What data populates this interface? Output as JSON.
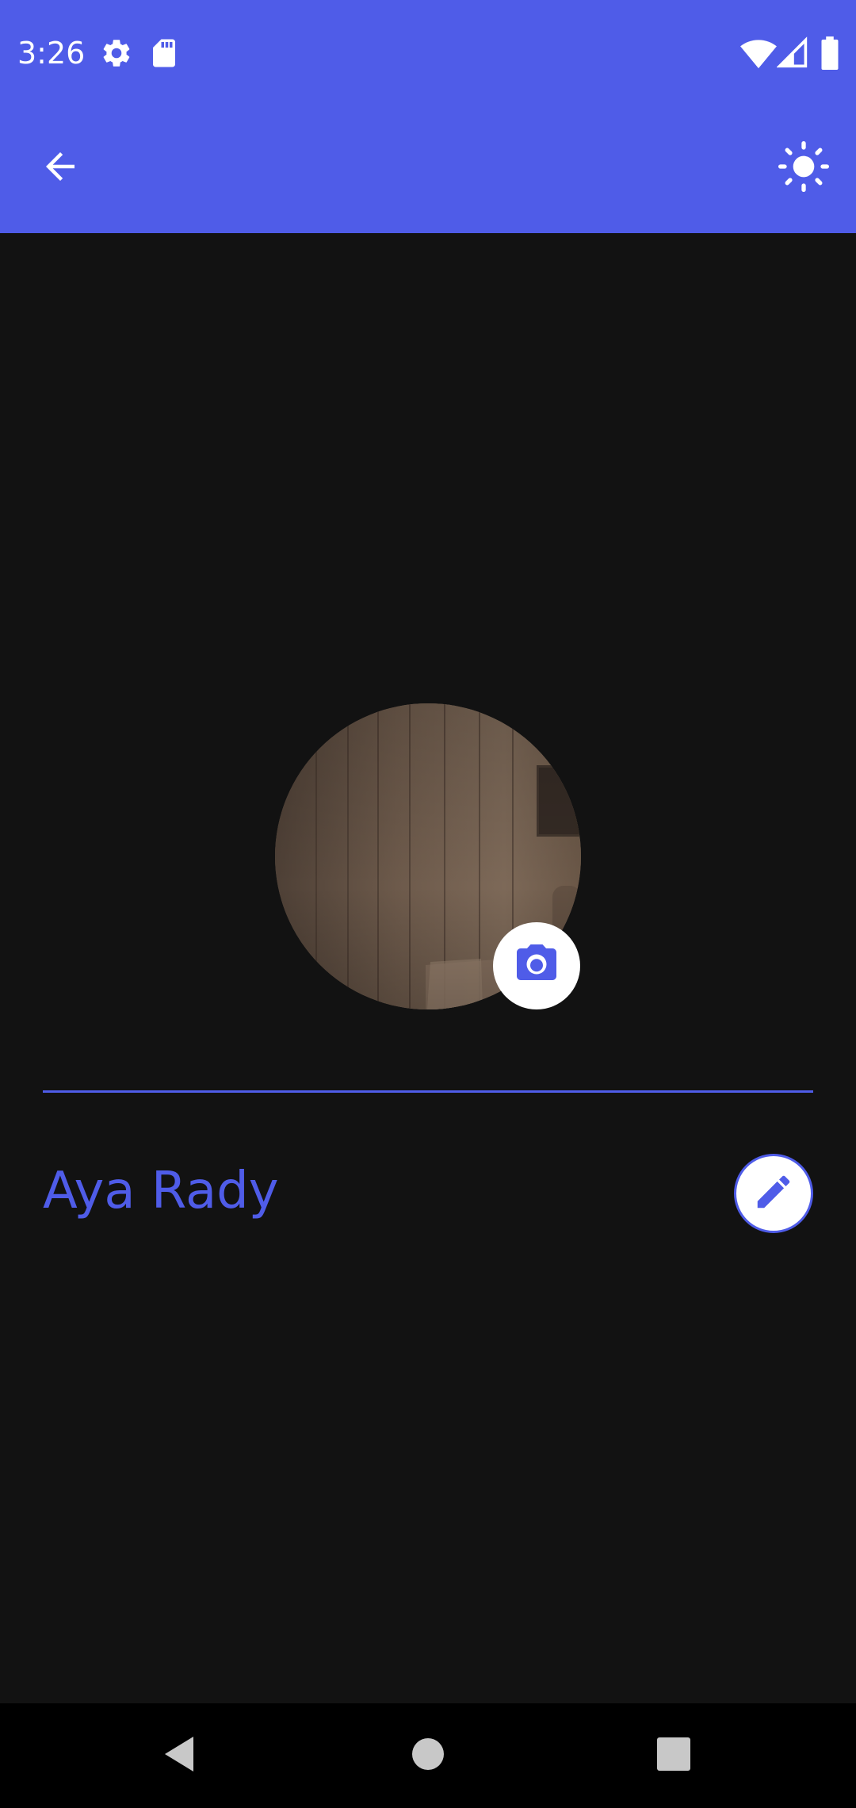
{
  "status_bar": {
    "time": "3:26",
    "icons": [
      "settings-icon",
      "sd-card-icon",
      "wifi-icon",
      "signal-icon",
      "battery-icon"
    ]
  },
  "app_bar": {
    "back_icon": "arrow-left-icon",
    "theme_icon": "sun-icon"
  },
  "profile": {
    "name": "Aya Rady",
    "camera_icon": "camera-icon",
    "edit_icon": "pencil-icon"
  },
  "nav_bar": {
    "icons": [
      "back-triangle-icon",
      "home-circle-icon",
      "recents-square-icon"
    ]
  },
  "colors": {
    "primary": "#4f5ce8",
    "background": "#121212",
    "nav_bar": "#000000"
  }
}
